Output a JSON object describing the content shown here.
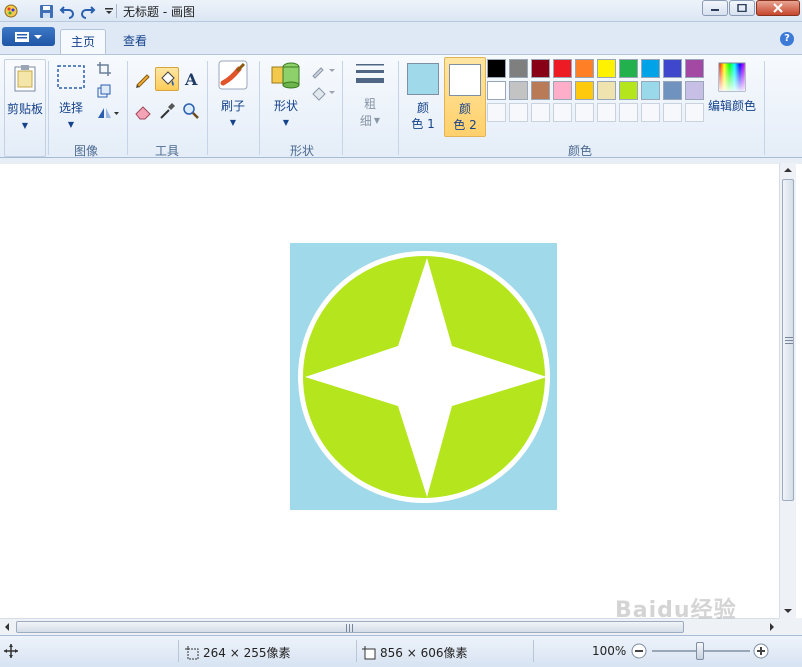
{
  "window": {
    "title": "无标题 - 画图"
  },
  "tabs": {
    "home": "主页",
    "view": "查看"
  },
  "help": "?",
  "ribbon": {
    "clipboard_label": "剪贴板",
    "select_label": "选择",
    "image_group": "图像",
    "tools_group": "工具",
    "brush_label": "刷子",
    "shapes_label": "形状",
    "shapes_group": "形状",
    "size_label_1": "粗",
    "size_label_2": "细",
    "color1_label_1": "颜",
    "color1_label_2": "色 1",
    "color2_label_1": "颜",
    "color2_label_2": "色 2",
    "edit_colors_label": "编辑颜色",
    "colors_group": "颜色",
    "color1_value": "#a0d9ea",
    "color2_value": "#ffffff",
    "palette_row1": [
      "#000000",
      "#7f7f7f",
      "#880015",
      "#ed1c24",
      "#ff7f27",
      "#fff200",
      "#22b14c",
      "#00a2e8",
      "#3f48cc",
      "#a349a4"
    ],
    "palette_row2": [
      "#ffffff",
      "#c3c3c3",
      "#b97a57",
      "#ffaec9",
      "#ffc90e",
      "#efe4b0",
      "#b5e61d",
      "#99d9ea",
      "#7092be",
      "#c8bfe7"
    ]
  },
  "canvas": {
    "background": "#a0d9ea",
    "circle_color": "#b5e61d",
    "star_color": "#ffffff"
  },
  "status": {
    "selection_size": "264 × 255像素",
    "canvas_size": "856 × 606像素",
    "zoom": "100%"
  },
  "watermark": "Baidu经验"
}
